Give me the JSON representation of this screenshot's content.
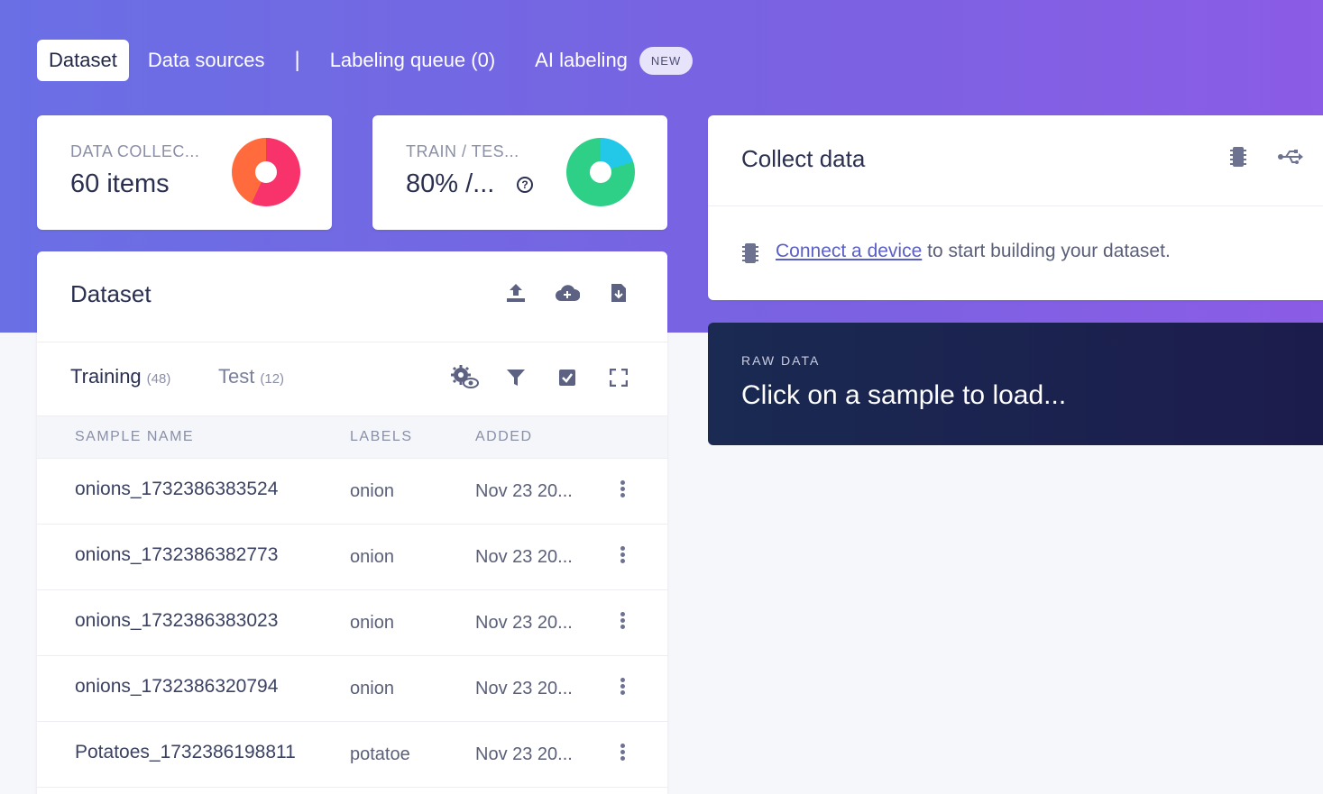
{
  "nav": {
    "tabs": [
      {
        "label": "Dataset"
      },
      {
        "label": "Data sources"
      },
      {
        "label": "|"
      },
      {
        "label": "Labeling queue (0)"
      },
      {
        "label": "AI labeling"
      }
    ],
    "new_badge": "NEW"
  },
  "stats": {
    "collected": {
      "label": "DATA COLLEC...",
      "value": "60 items",
      "donut_colors": [
        "#f8326a",
        "#ff6b3d"
      ]
    },
    "split": {
      "label": "TRAIN / TES...",
      "value": "80% /...",
      "help_icon": "?",
      "donut_colors": [
        "#2ecf86",
        "#23c8e8"
      ],
      "train_fraction": 0.8
    }
  },
  "dataset": {
    "title": "Dataset",
    "actions": [
      "upload-icon",
      "cloud-upload-icon",
      "download-icon"
    ],
    "subtabs": [
      {
        "label": "Training",
        "count": "(48)"
      },
      {
        "label": "Test",
        "count": "(12)"
      }
    ],
    "toolbar": [
      "settings-eye-icon",
      "filter-icon",
      "select-checkbox-icon",
      "expand-icon"
    ],
    "columns": [
      "SAMPLE NAME",
      "LABELS",
      "ADDED"
    ],
    "rows": [
      {
        "name": "onions_1732386383524",
        "label": "onion",
        "added": "Nov 23 20..."
      },
      {
        "name": "onions_1732386382773",
        "label": "onion",
        "added": "Nov 23 20..."
      },
      {
        "name": "onions_1732386383023",
        "label": "onion",
        "added": "Nov 23 20..."
      },
      {
        "name": "onions_1732386320794",
        "label": "onion",
        "added": "Nov 23 20..."
      },
      {
        "name": "Potatoes_1732386198811",
        "label": "potatoe",
        "added": "Nov 23 20..."
      }
    ]
  },
  "collect": {
    "title": "Collect data",
    "link_text": "Connect a device",
    "rest_text": " to start building your dataset."
  },
  "raw": {
    "label": "RAW DATA",
    "text": "Click on a sample to load..."
  },
  "colors": {
    "hero_start": "#6a6fe4",
    "hero_end": "#8b5ce6",
    "raw_bg": "#1a2a52",
    "link": "#5a5fc8"
  }
}
